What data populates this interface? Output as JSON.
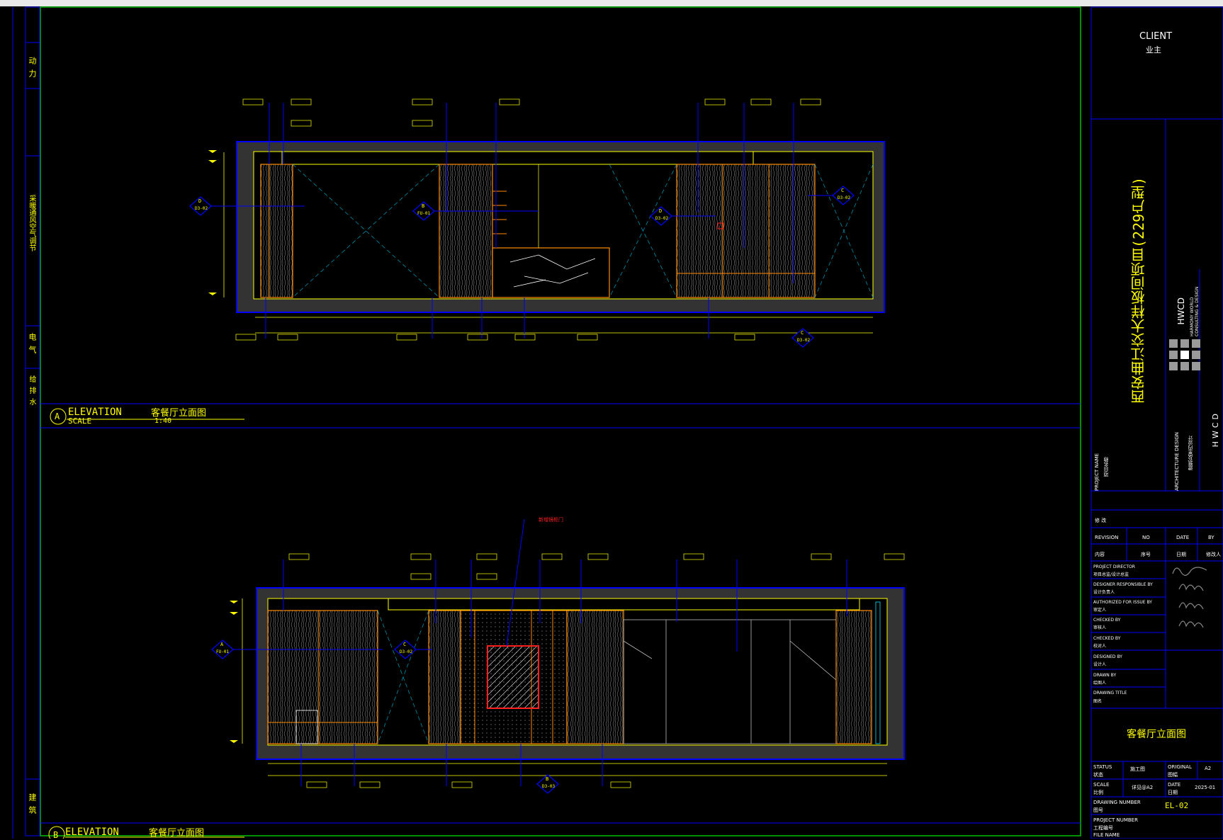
{
  "title_block": {
    "client_en": "CLIENT",
    "client_cn": "业主",
    "project_name_cn": "西安曲江交大样板间项目(229户型)",
    "company_short": "HWCD",
    "company_full": "HARMONY WORLD CONSULTING & DESIGN",
    "company_vertical": "HWCD",
    "project_name_label": "PROJECT NAME",
    "project_name_label_cn": "项目名称",
    "arch_design_label": "ARCHITECTURE DESIGN",
    "arch_design_label_cn": "建筑及室内设计",
    "rev_title": "修    改",
    "revision_label": "REVISION",
    "no_label": "NO",
    "date_label": "DATE",
    "by_label": "BY",
    "content_label": "内容",
    "seq_label": "序号",
    "date_cn": "日期",
    "by_cn": "修改人",
    "project_director": "PROJECT DIRECTOR",
    "project_director_cn": "项目总监/设计总监",
    "designer_resp": "DESIGNER RESPONSIBLE BY",
    "designer_resp_cn": "设计负责人",
    "authorized": "AUTHORIZED FOR ISSUE BY",
    "authorized_cn": "审定人",
    "checked": "CHECKED BY",
    "checked_cn": "审核人",
    "checked2": "CHECKED BY",
    "checked2_cn": "校对人",
    "designed": "DESIGNED BY",
    "designed_cn": "设计人",
    "drawn": "DRAWN BY",
    "drawn_cn": "绘图人",
    "drawing_title_label": "DRAWING TITLE",
    "drawing_title_label_cn": "图名",
    "drawing_title": "客餐厅立面图",
    "status_label": "STATUS",
    "status_label_cn": "状态",
    "status_value": "施工图",
    "scale_label": "SCALE",
    "scale_label_cn": "比例",
    "scale_value": "详见@A2",
    "original_label": "ORIGINAL",
    "original_label_cn": "图幅",
    "original_value": "A2",
    "date2_label": "DATE",
    "date2_label_cn": "日期",
    "date_value": "2025-01",
    "drawing_number_label": "DRAWING NUMBER",
    "drawing_number_label_cn": "图号",
    "drawing_number": "EL-02",
    "project_number_label": "PROJECT NUMBER",
    "project_number_label_cn": "工程编号",
    "file_name_label": "FILE NAME"
  },
  "left_strip": {
    "label1": "动 力",
    "label2": "采暖通风空气调节",
    "label3": "电 气",
    "label4": "给 排 水",
    "label5": "建 筑"
  },
  "elevation_a": {
    "letter": "A",
    "title_en": "ELEVATION",
    "title_cn": "客餐厅立面图",
    "scale_label": "SCALE",
    "scale_value": "1:40"
  },
  "elevation_b": {
    "letter": "B",
    "title_en": "ELEVATION",
    "title_cn": "客餐厅立面图"
  },
  "callouts_a": [
    {
      "code": "D",
      "ref": "D3-02"
    },
    {
      "code": "B",
      "ref": "FU-01"
    },
    {
      "code": "D",
      "ref": "D3-02"
    },
    {
      "code": "C",
      "ref": "D3-02"
    },
    {
      "code": "C",
      "ref": "D3-02"
    }
  ],
  "callouts_b": [
    {
      "code": "A",
      "ref": "FU-01"
    },
    {
      "code": "C",
      "ref": "D3-02"
    },
    {
      "code": "B",
      "ref": "D3-03"
    }
  ],
  "red_note": "新增镜柜门",
  "colors": {
    "frame": "#0000ff",
    "sheet_border": "#00c000",
    "text": "#ffff00",
    "wall": "#ff8c00",
    "wall_fill": "#3c3c3c",
    "red": "#ff2020",
    "cyan": "#00e5ff"
  }
}
